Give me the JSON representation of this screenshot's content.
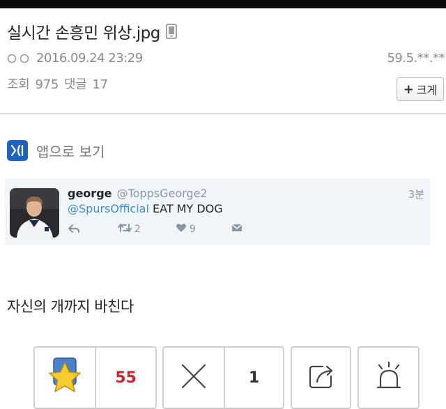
{
  "post": {
    "title": "실시간 손흥민 위상.jpg",
    "author_timestamp": "2016.09.24 23:29",
    "ip": "59.5.**.**",
    "views_label": "조회",
    "views": "975",
    "comments_label": "댓글",
    "comments": "17",
    "zoom_label": "크게",
    "body": "자신의 개까지 바친다"
  },
  "app_link": {
    "label": "앱으로 보기"
  },
  "tweet": {
    "name": "george",
    "handle": "@ToppsGeorge2",
    "time": "3분",
    "mention": "@SpursOfficial",
    "text": " EAT MY DOG",
    "retweets": "2",
    "likes": "9"
  },
  "reactions": {
    "upvote_count": "55",
    "downvote_count": "1"
  },
  "icons": {
    "mobile": "mobile-phone-icon",
    "author": "author-rings-icon",
    "app": "app-logo-icon",
    "reply": "reply-icon",
    "retweet": "retweet-icon",
    "like": "heart-icon",
    "dm": "envelope-icon",
    "upvote": "star-icon",
    "downvote": "x-icon",
    "share": "share-icon",
    "report": "siren-icon"
  },
  "colors": {
    "app_blue": "#1e63c4",
    "mention_blue": "#3b8fd4",
    "upvote_red": "#c8262a",
    "tweet_bg": "#f0f5fa",
    "star_yellow": "#f7cc2e",
    "star_tile_blue": "#4a82c9"
  }
}
